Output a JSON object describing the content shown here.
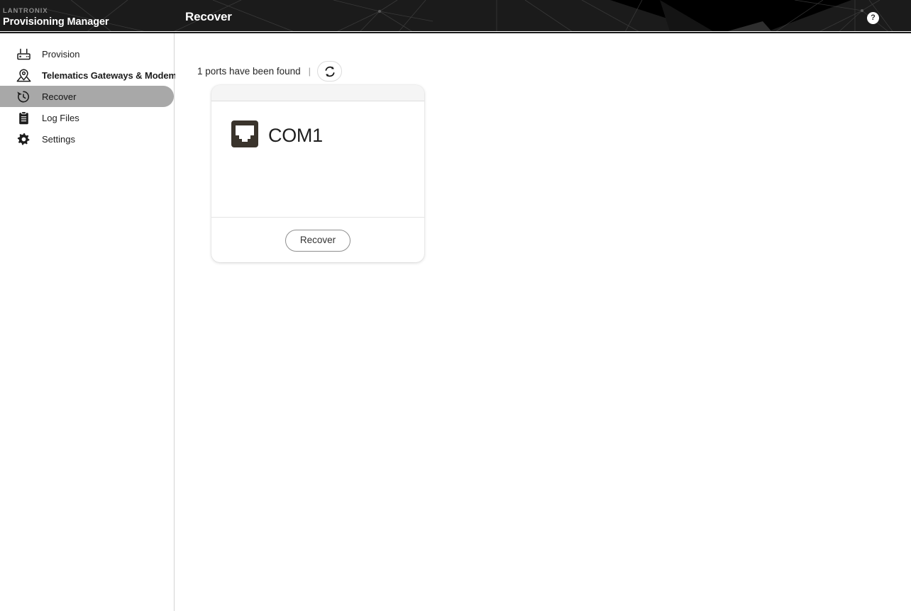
{
  "header": {
    "brand_logo": "LANTRONIX",
    "brand_title": "Provisioning Manager",
    "page_title": "Recover",
    "help_label": "?",
    "background_color": "#1b1b1b",
    "text_color": "#ffffff"
  },
  "sidebar": {
    "items": [
      {
        "label": "Provision",
        "icon": "router-icon",
        "active": false
      },
      {
        "label": "Telematics Gateways & Modems",
        "icon": "map-pin-icon",
        "active": false
      },
      {
        "label": "Recover",
        "icon": "history-icon",
        "active": true
      },
      {
        "label": "Log Files",
        "icon": "clipboard-icon",
        "active": false
      },
      {
        "label": "Settings",
        "icon": "gear-icon",
        "active": false
      }
    ],
    "active_highlight_color": "#a8a8a8"
  },
  "main": {
    "status_text": "1 ports have been found",
    "status_separator": "|",
    "refresh_icon": "refresh-icon",
    "cards": [
      {
        "port_icon": "ethernet-port-icon",
        "port_name": "COM1",
        "action_label": "Recover"
      }
    ]
  }
}
